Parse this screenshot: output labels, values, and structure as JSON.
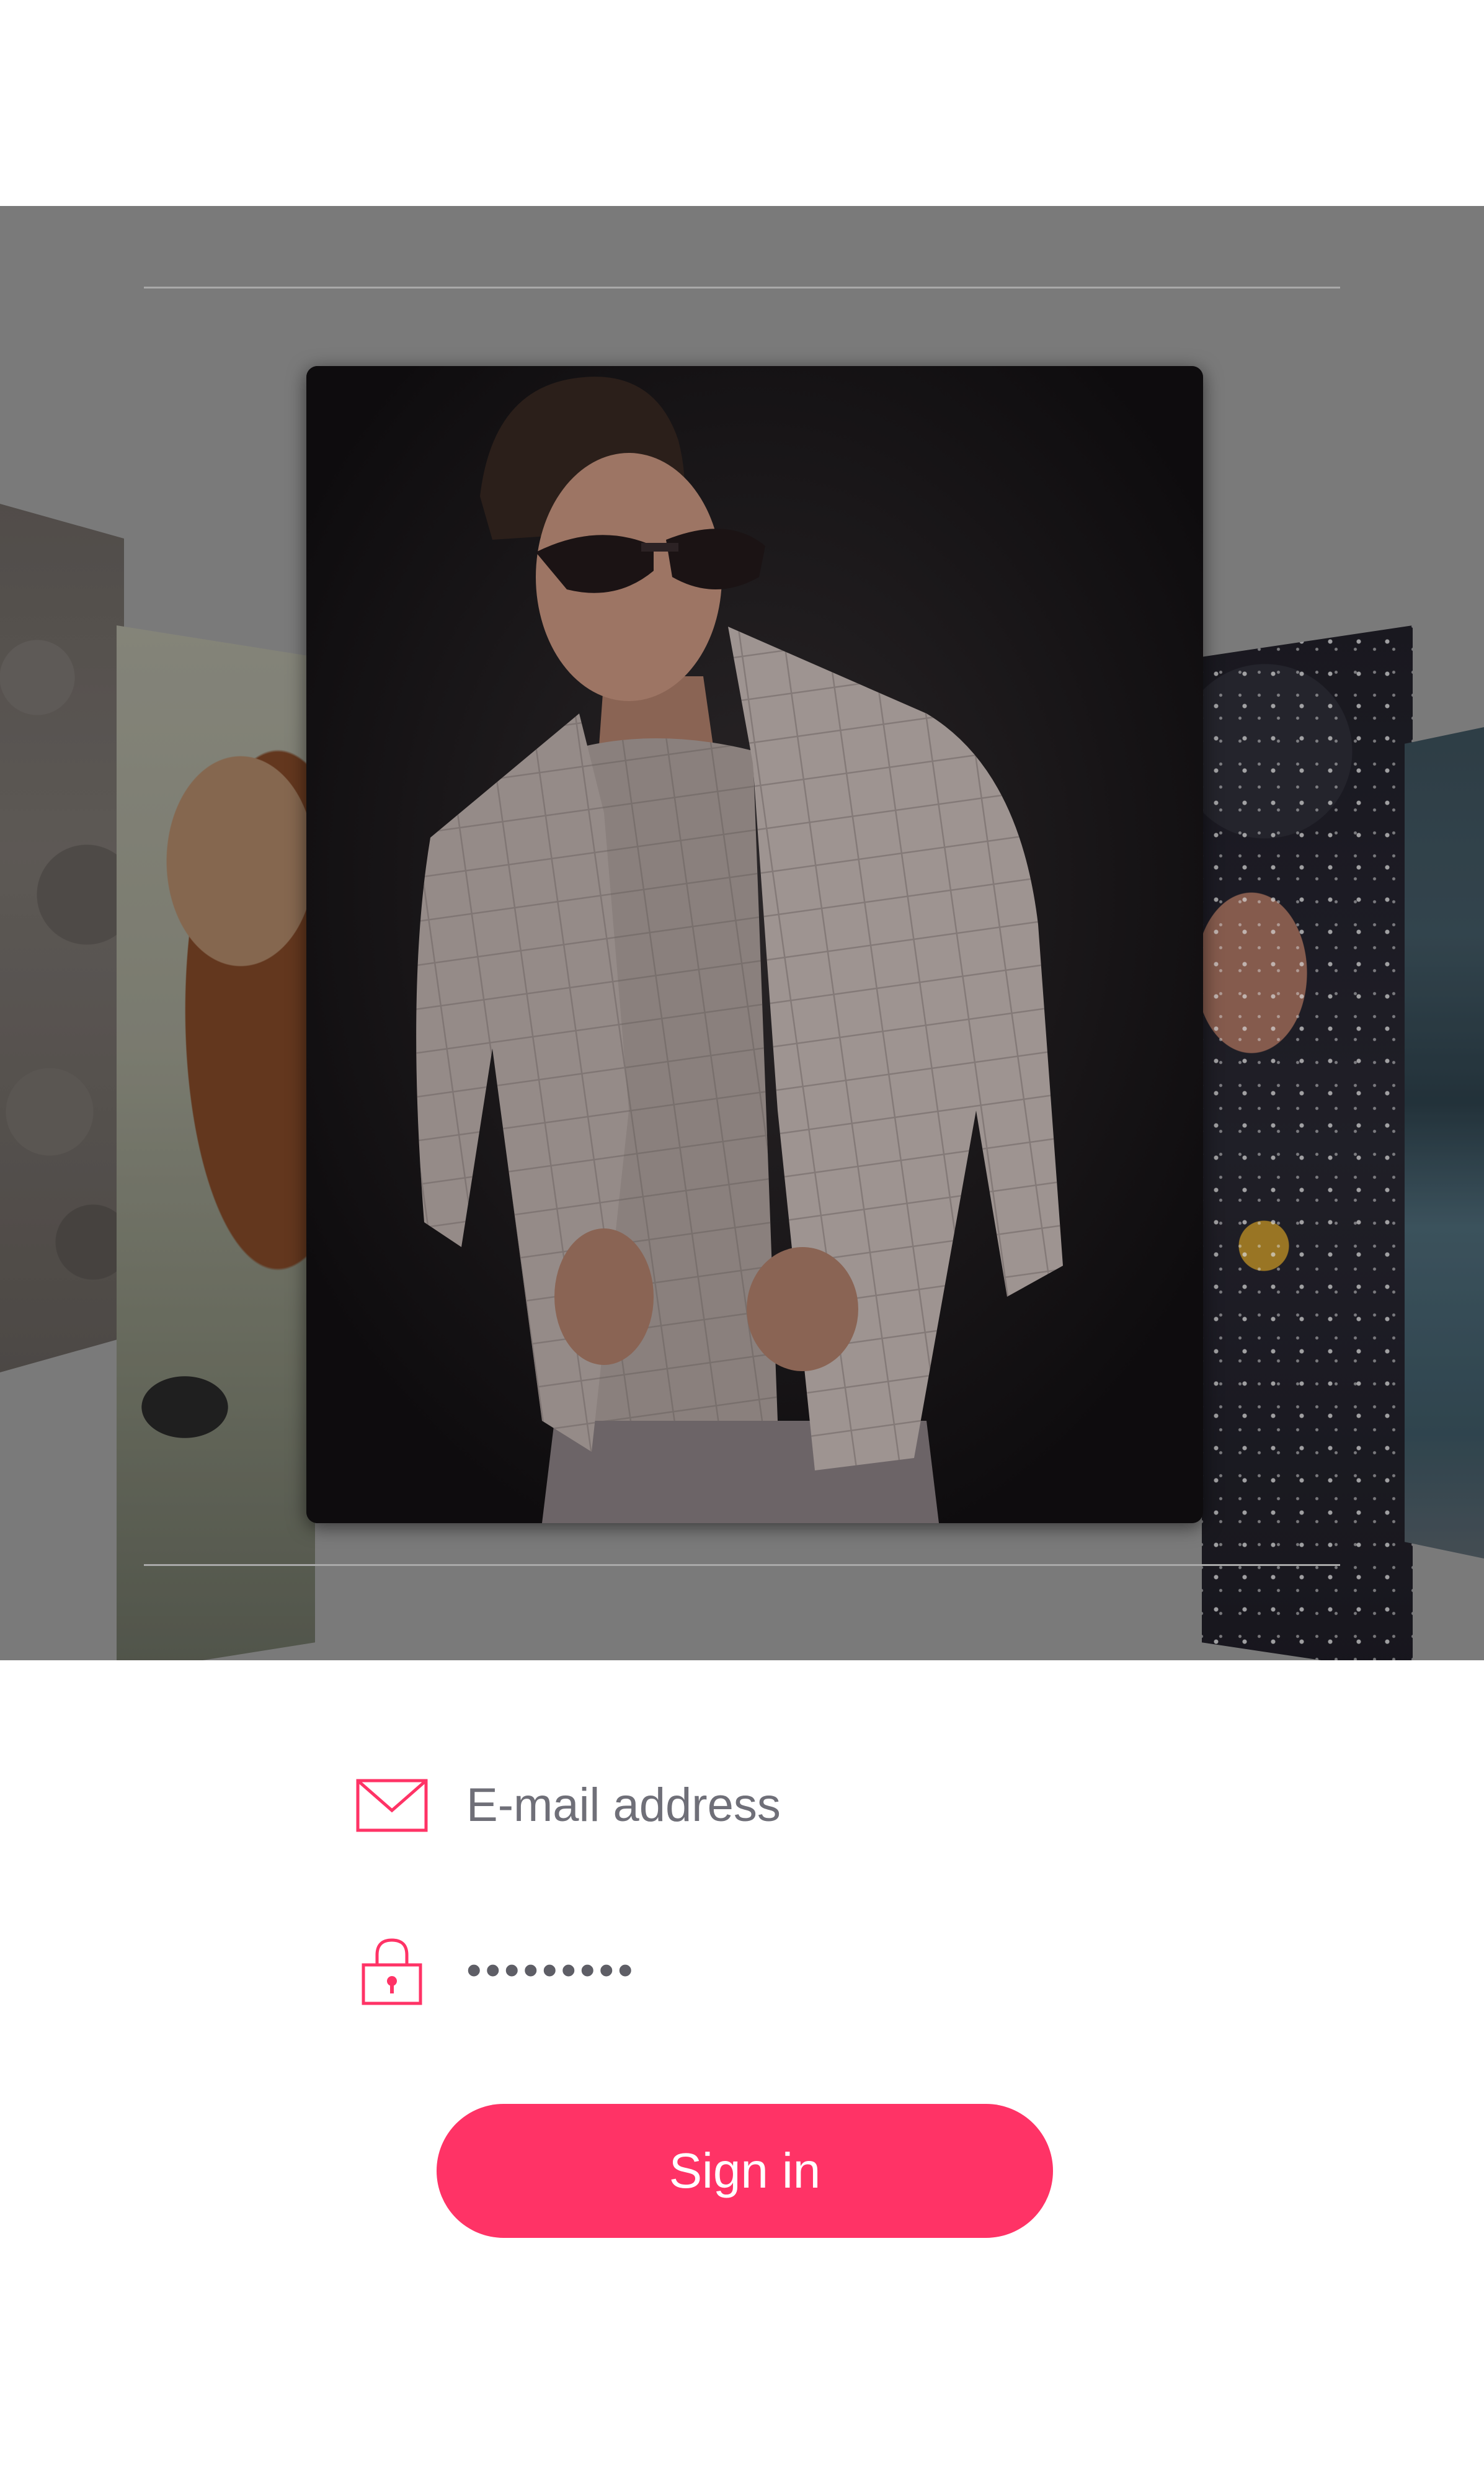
{
  "gallery": {
    "photos": [
      {
        "subject": "rocky beach"
      },
      {
        "subject": "woman with sunglasses"
      },
      {
        "subject": "man in sunglasses and textured blazer"
      },
      {
        "subject": "woman in snow"
      },
      {
        "subject": "lake landscape"
      }
    ]
  },
  "login": {
    "email": {
      "icon": "envelope-icon",
      "placeholder": "E-mail address",
      "value": ""
    },
    "password": {
      "icon": "lock-icon",
      "masked_value": "•••••••••"
    },
    "signin_label": "Sign in"
  },
  "colors": {
    "accent": "#ff3366",
    "overlay": "#7a7a7a",
    "text": "#6f6f78",
    "background": "#ffffff"
  }
}
